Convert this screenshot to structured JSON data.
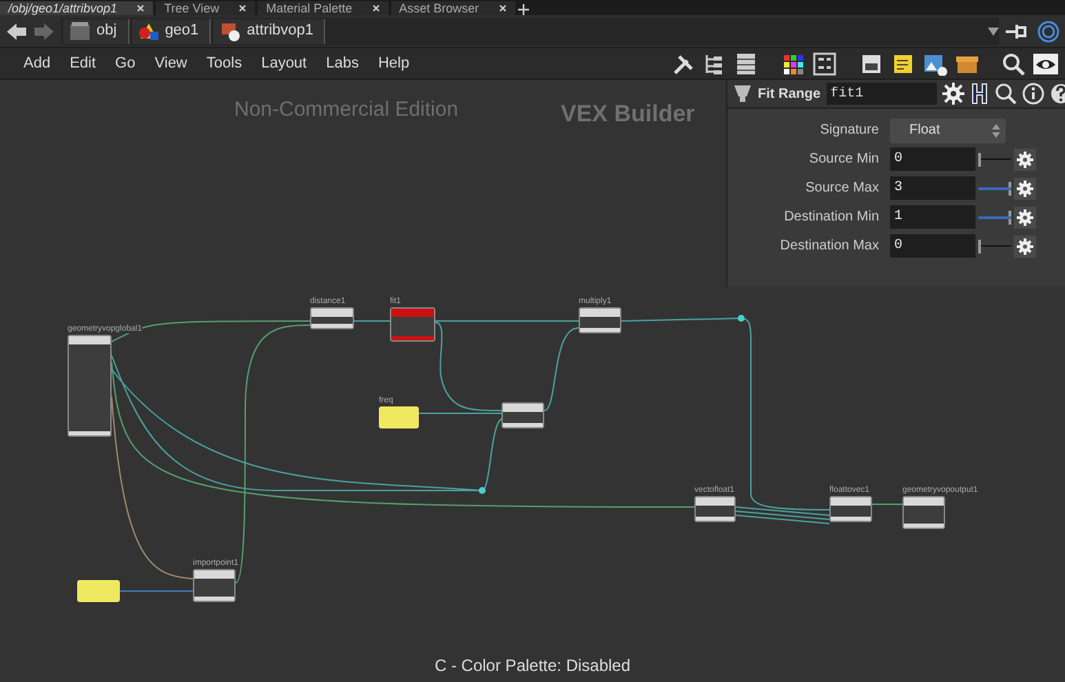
{
  "tabs": [
    {
      "label": "/obj/geo1/attribvop1",
      "selected": true
    },
    {
      "label": "Tree View",
      "selected": false
    },
    {
      "label": "Material Palette",
      "selected": false
    },
    {
      "label": "Asset Browser",
      "selected": false
    }
  ],
  "path": [
    {
      "label": "obj",
      "kind": "obj"
    },
    {
      "label": "geo1",
      "kind": "geo"
    },
    {
      "label": "attribvop1",
      "kind": "vop"
    }
  ],
  "menu": [
    "Add",
    "Edit",
    "Go",
    "View",
    "Tools",
    "Layout",
    "Labs",
    "Help"
  ],
  "network": {
    "edition": "Non-Commercial Edition",
    "context": "VEX Builder",
    "nodes": [
      {
        "name": "geometryvopglobal1",
        "kind": "global",
        "color": "#d8d8d8"
      },
      {
        "name": "distance1",
        "kind": "op",
        "color": "#d8d8d8"
      },
      {
        "name": "fit1",
        "kind": "op",
        "color": "#cc1111"
      },
      {
        "name": "multiply1",
        "kind": "op",
        "color": "#d8d8d8"
      },
      {
        "name": "freq",
        "kind": "param",
        "color": "#f0e860"
      },
      {
        "kind": "op",
        "color": "#d8d8d8"
      },
      {
        "name": "vectofloat1",
        "kind": "op",
        "color": "#d8d8d8"
      },
      {
        "name": "floattovec1",
        "kind": "op",
        "color": "#d8d8d8"
      },
      {
        "name": "geometryvopoutput1",
        "kind": "output",
        "color": "#d8d8d8"
      },
      {
        "name": "importpoint1",
        "kind": "op",
        "color": "#d8d8d8"
      },
      {
        "kind": "param",
        "color": "#f0e860"
      }
    ]
  },
  "parameters": {
    "type": "Fit Range",
    "name": "fit1",
    "rows": [
      {
        "label": "Signature",
        "kind": "menu",
        "value": "Float"
      },
      {
        "label": "Source Min",
        "kind": "slider",
        "value": "0",
        "level": 0
      },
      {
        "label": "Source Max",
        "kind": "slider",
        "value": "3",
        "level": 1
      },
      {
        "label": "Destination Min",
        "kind": "slider",
        "value": "1",
        "level": 1
      },
      {
        "label": "Destination Max",
        "kind": "slider",
        "value": "0",
        "level": 0
      }
    ]
  },
  "status": "C - Color Palette: Disabled"
}
